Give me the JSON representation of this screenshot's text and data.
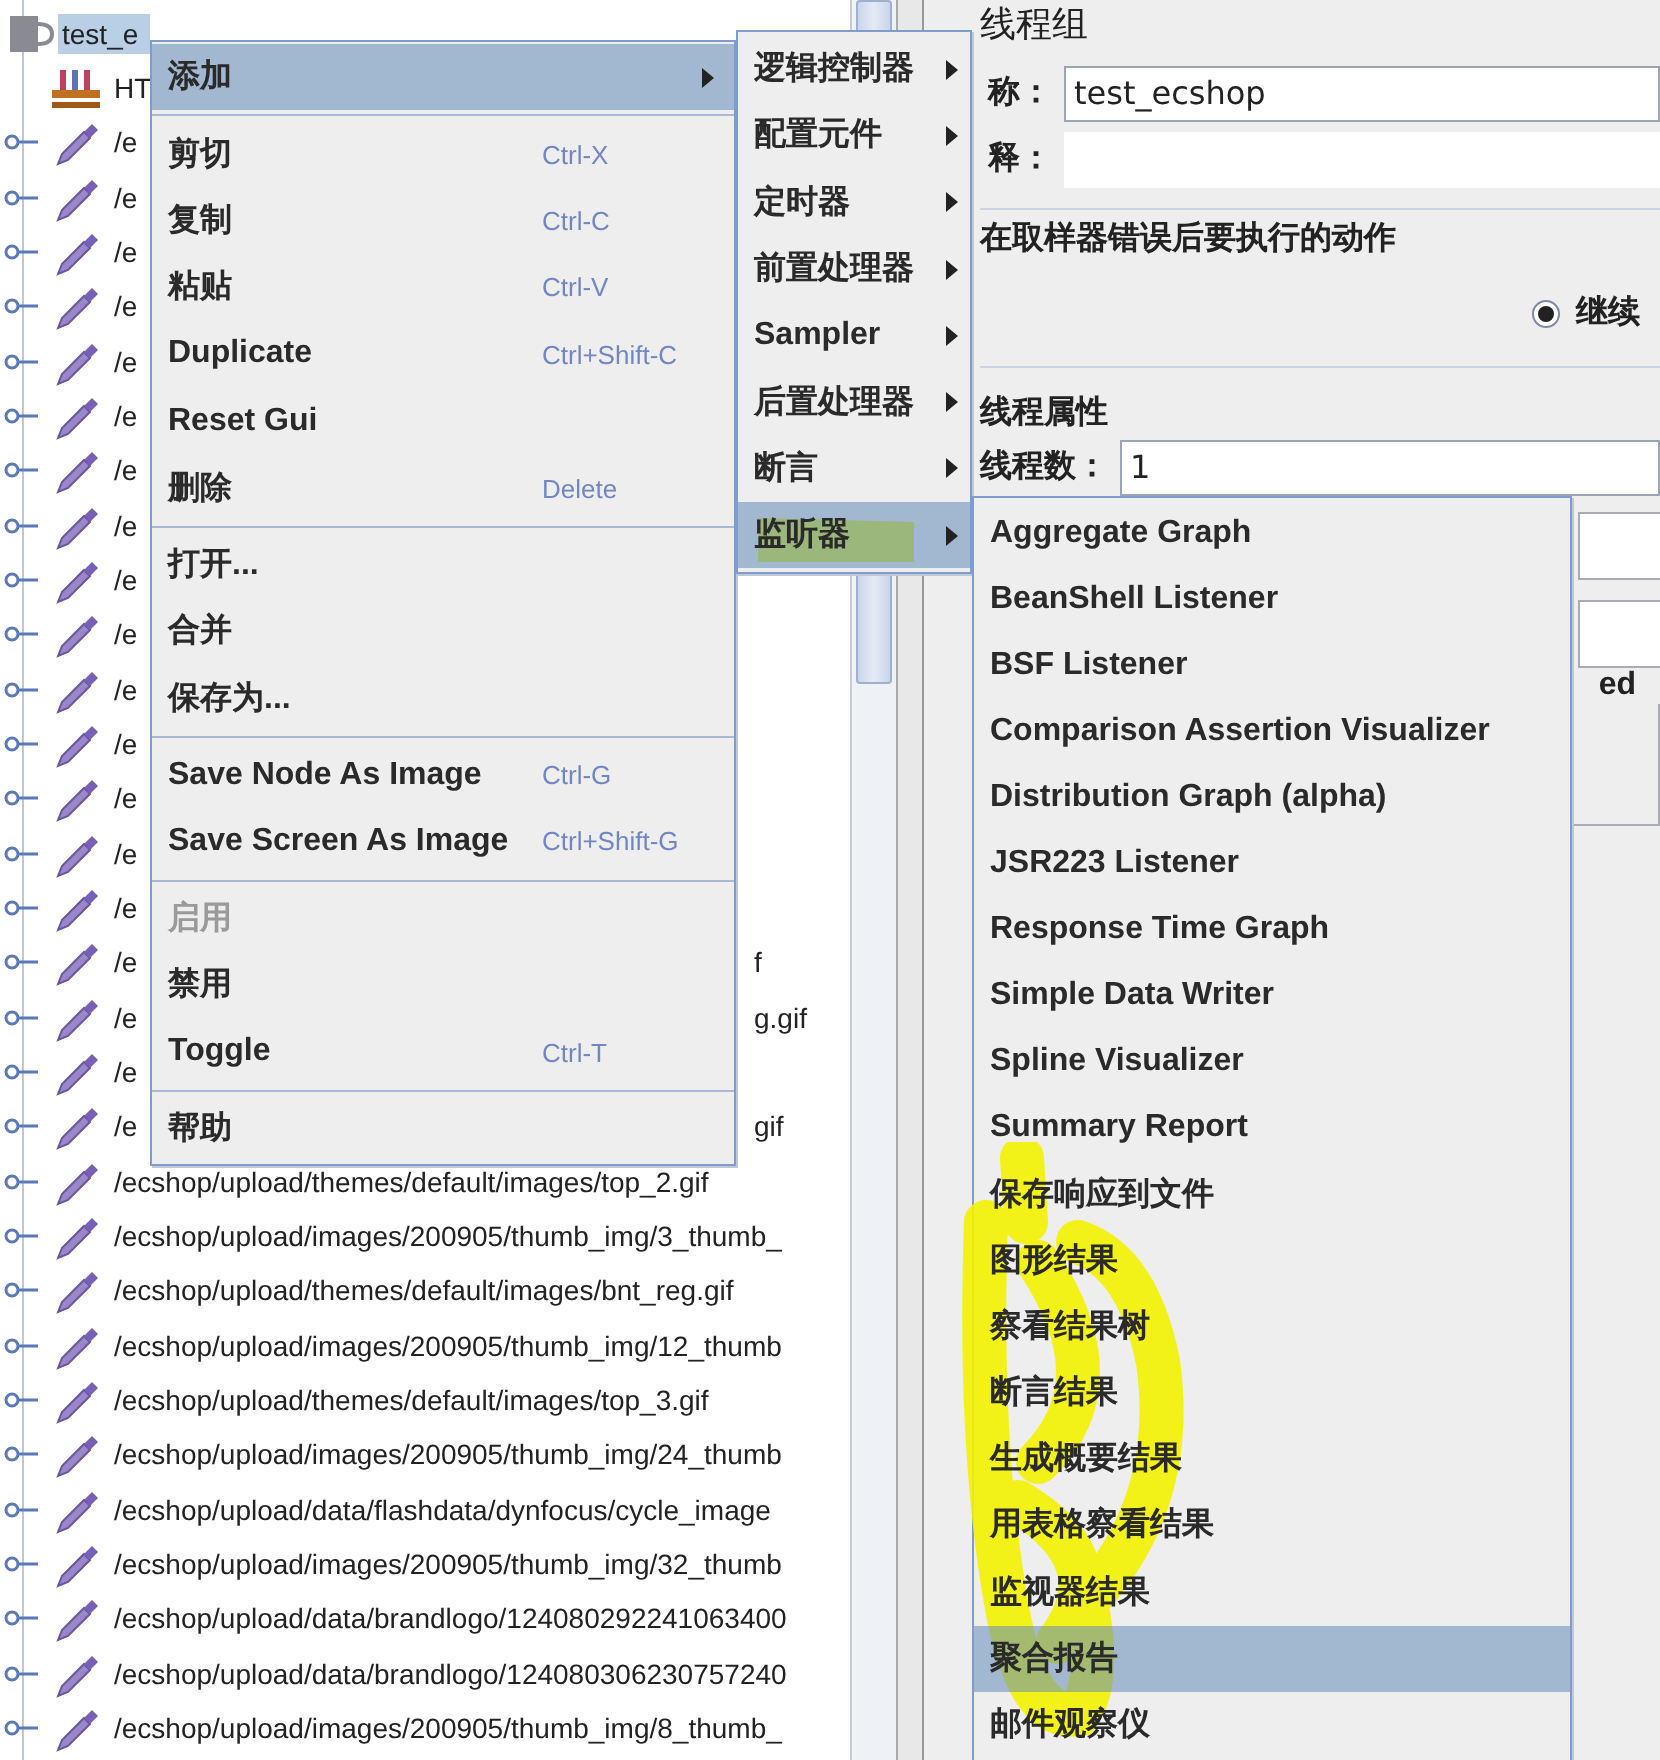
{
  "tree": {
    "nodes": [
      {
        "kind": "thread-group",
        "label": "test_e",
        "selected": true
      },
      {
        "kind": "http-defaults",
        "label": "HT",
        "selected": false
      },
      {
        "kind": "sampler",
        "label": "/e",
        "selected": false
      },
      {
        "kind": "sampler",
        "label": "/e",
        "selected": false
      },
      {
        "kind": "sampler",
        "label": "/e",
        "selected": false
      },
      {
        "kind": "sampler",
        "label": "/e",
        "selected": false
      },
      {
        "kind": "sampler",
        "label": "/e",
        "selected": false
      },
      {
        "kind": "sampler",
        "label": "/e",
        "selected": false
      },
      {
        "kind": "sampler",
        "label": "/e",
        "selected": false
      },
      {
        "kind": "sampler",
        "label": "/e",
        "selected": false
      },
      {
        "kind": "sampler",
        "label": "/e",
        "selected": false
      },
      {
        "kind": "sampler",
        "label": "/e",
        "selected": false
      },
      {
        "kind": "sampler",
        "label": "/e",
        "selected": false
      },
      {
        "kind": "sampler",
        "label": "/e",
        "selected": false
      },
      {
        "kind": "sampler",
        "label": "/e",
        "selected": false
      },
      {
        "kind": "sampler",
        "label": "/e",
        "selected": false
      },
      {
        "kind": "sampler",
        "label": "/e",
        "selected": false
      },
      {
        "kind": "sampler",
        "label": "/e",
        "tail": "f",
        "selected": false
      },
      {
        "kind": "sampler",
        "label": "/e",
        "tail": "g.gif",
        "selected": false
      },
      {
        "kind": "sampler",
        "label": "/e",
        "selected": false
      },
      {
        "kind": "sampler",
        "label": "/e",
        "tail": "gif",
        "selected": false
      },
      {
        "kind": "sampler",
        "label": "/ecshop/upload/themes/default/images/top_2.gif",
        "selected": false
      },
      {
        "kind": "sampler",
        "label": "/ecshop/upload/images/200905/thumb_img/3_thumb_",
        "selected": false
      },
      {
        "kind": "sampler",
        "label": "/ecshop/upload/themes/default/images/bnt_reg.gif",
        "selected": false
      },
      {
        "kind": "sampler",
        "label": "/ecshop/upload/images/200905/thumb_img/12_thumb",
        "selected": false
      },
      {
        "kind": "sampler",
        "label": "/ecshop/upload/themes/default/images/top_3.gif",
        "selected": false
      },
      {
        "kind": "sampler",
        "label": "/ecshop/upload/images/200905/thumb_img/24_thumb",
        "selected": false
      },
      {
        "kind": "sampler",
        "label": "/ecshop/upload/data/flashdata/dynfocus/cycle_image",
        "selected": false
      },
      {
        "kind": "sampler",
        "label": "/ecshop/upload/images/200905/thumb_img/32_thumb",
        "selected": false
      },
      {
        "kind": "sampler",
        "label": "/ecshop/upload/data/brandlogo/124080292241063400",
        "selected": false
      },
      {
        "kind": "sampler",
        "label": "/ecshop/upload/data/brandlogo/124080306230757240",
        "selected": false
      },
      {
        "kind": "sampler",
        "label": "/ecshop/upload/images/200905/thumb_img/8_thumb_",
        "selected": false
      }
    ]
  },
  "panel": {
    "title": "线程组",
    "name_label": "称：",
    "name_value": "test_ecshop",
    "comment_label": "释：",
    "error_section": "在取样器错误后要执行的动作",
    "radio": {
      "label": "继续",
      "selected": true
    },
    "thread_section": "线程属性",
    "threads_label": "线程数：",
    "threads_value": "1",
    "tail_text": "ed"
  },
  "context_menu": {
    "items": [
      {
        "kind": "item",
        "label": "添加",
        "submenu": true,
        "selected": true,
        "disabled": false
      },
      {
        "kind": "separator"
      },
      {
        "kind": "item",
        "label": "剪切",
        "shortcut": "Ctrl-X",
        "selected": false,
        "disabled": false
      },
      {
        "kind": "item",
        "label": "复制",
        "shortcut": "Ctrl-C",
        "selected": false,
        "disabled": false
      },
      {
        "kind": "item",
        "label": "粘贴",
        "shortcut": "Ctrl-V",
        "selected": false,
        "disabled": false
      },
      {
        "kind": "item",
        "label": "Duplicate",
        "shortcut": "Ctrl+Shift-C",
        "selected": false,
        "disabled": false
      },
      {
        "kind": "item",
        "label": "Reset Gui",
        "selected": false,
        "disabled": false
      },
      {
        "kind": "item",
        "label": "删除",
        "shortcut": "Delete",
        "selected": false,
        "disabled": false
      },
      {
        "kind": "separator"
      },
      {
        "kind": "item",
        "label": "打开...",
        "selected": false,
        "disabled": false
      },
      {
        "kind": "item",
        "label": "合并",
        "selected": false,
        "disabled": false
      },
      {
        "kind": "item",
        "label": "保存为...",
        "selected": false,
        "disabled": false
      },
      {
        "kind": "separator"
      },
      {
        "kind": "item",
        "label": "Save Node As Image",
        "shortcut": "Ctrl-G",
        "selected": false,
        "disabled": false
      },
      {
        "kind": "item",
        "label": "Save Screen As Image",
        "shortcut": "Ctrl+Shift-G",
        "selected": false,
        "disabled": false
      },
      {
        "kind": "separator"
      },
      {
        "kind": "item",
        "label": "启用",
        "selected": false,
        "disabled": true
      },
      {
        "kind": "item",
        "label": "禁用",
        "selected": false,
        "disabled": false
      },
      {
        "kind": "item",
        "label": "Toggle",
        "shortcut": "Ctrl-T",
        "selected": false,
        "disabled": false
      },
      {
        "kind": "separator"
      },
      {
        "kind": "item",
        "label": "帮助",
        "selected": false,
        "disabled": false
      }
    ]
  },
  "add_submenu": {
    "items": [
      {
        "label": "逻辑控制器",
        "selected": false
      },
      {
        "label": "配置元件",
        "selected": false
      },
      {
        "label": "定时器",
        "selected": false
      },
      {
        "label": "前置处理器",
        "selected": false
      },
      {
        "label": "Sampler",
        "selected": false
      },
      {
        "label": "后置处理器",
        "selected": false
      },
      {
        "label": "断言",
        "selected": false
      },
      {
        "label": "监听器",
        "selected": true
      }
    ]
  },
  "listener_submenu": {
    "items": [
      {
        "label": "Aggregate Graph",
        "selected": false
      },
      {
        "label": "BeanShell Listener",
        "selected": false
      },
      {
        "label": "BSF Listener",
        "selected": false
      },
      {
        "label": "Comparison Assertion Visualizer",
        "selected": false
      },
      {
        "label": "Distribution Graph (alpha)",
        "selected": false
      },
      {
        "label": "JSR223 Listener",
        "selected": false
      },
      {
        "label": "Response Time Graph",
        "selected": false
      },
      {
        "label": "Simple Data Writer",
        "selected": false
      },
      {
        "label": "Spline Visualizer",
        "selected": false
      },
      {
        "label": "Summary Report",
        "selected": false
      },
      {
        "label": "保存响应到文件",
        "selected": false
      },
      {
        "label": "图形结果",
        "selected": false
      },
      {
        "label": "察看结果树",
        "selected": false
      },
      {
        "label": "断言结果",
        "selected": false
      },
      {
        "label": "生成概要结果",
        "selected": false
      },
      {
        "label": "用表格察看结果",
        "selected": false
      },
      {
        "label": "监视器结果",
        "selected": false
      },
      {
        "label": "聚合报告",
        "selected": true
      },
      {
        "label": "邮件观察仪",
        "selected": false
      }
    ]
  }
}
